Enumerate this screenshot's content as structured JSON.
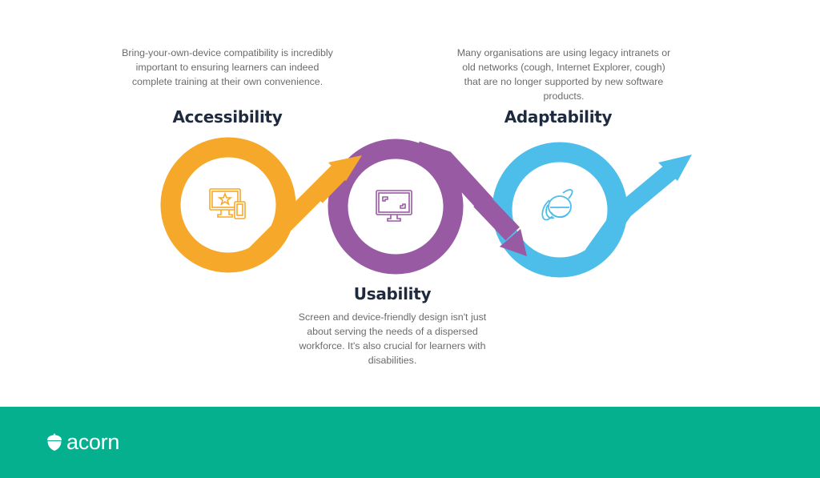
{
  "stages": [
    {
      "id": "accessibility",
      "title": "Accessibility",
      "description": "Bring-your-own-device compatibility is incredibly important to ensuring learners can indeed complete training at their own convenience.",
      "icon": "devices-star-icon",
      "color": "#f5a82a"
    },
    {
      "id": "usability",
      "title": "Usability",
      "description": "Screen and device-friendly design isn't just about serving the needs of a dispersed workforce. It's also crucial for learners with disabilities.",
      "icon": "monitor-fullscreen-icon",
      "color": "#995aa4"
    },
    {
      "id": "adaptability",
      "title": "Adaptability",
      "description": "Many organisations are using legacy intranets or old networks (cough, Internet Explorer, cough) that are no longer supported by new software products.",
      "icon": "internet-explorer-icon",
      "color": "#4dbdea"
    }
  ],
  "footer": {
    "brand": "acorn",
    "logo_icon": "acorn-icon",
    "background": "#05b08e"
  }
}
